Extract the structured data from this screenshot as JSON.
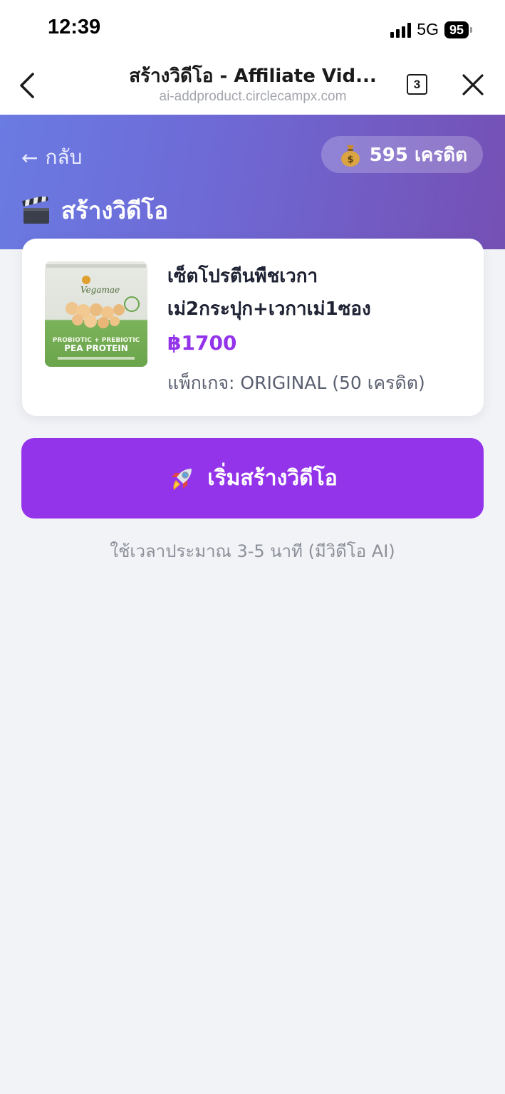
{
  "status_bar": {
    "time": "12:39",
    "network": "5G",
    "battery": "95"
  },
  "browser": {
    "title": "สร้างวิดีโอ - Affiliate Vid...",
    "url": "ai-addproduct.circlecampx.com",
    "tab_count": "3"
  },
  "header": {
    "back_label": "กลับ",
    "back_arrow": "←",
    "credits": "595 เครดิต",
    "title": "สร้างวิดีโอ"
  },
  "product": {
    "name_line1": "เซ็ตโปรตีนพืชเวกา",
    "name_line2": "เม่2กระปุก+เวกาเม่1ซอง",
    "price": "฿1700",
    "package": "แพ็กเกจ: ORIGINAL (50 เครดิต)",
    "image_brand": "Vegamae",
    "image_label": "PEA PROTEIN",
    "image_sub": "PROBIOTIC + PREBIOTIC"
  },
  "cta": {
    "label": "เริ่มสร้างวิดีโอ"
  },
  "hint": "ใช้เวลาประมาณ 3-5 นาที (มีวิดีโอ AI)",
  "colors": {
    "accent": "#9333ea",
    "gradient_start": "#6a7be2",
    "gradient_end": "#7550b4",
    "background": "#f2f3f6"
  }
}
